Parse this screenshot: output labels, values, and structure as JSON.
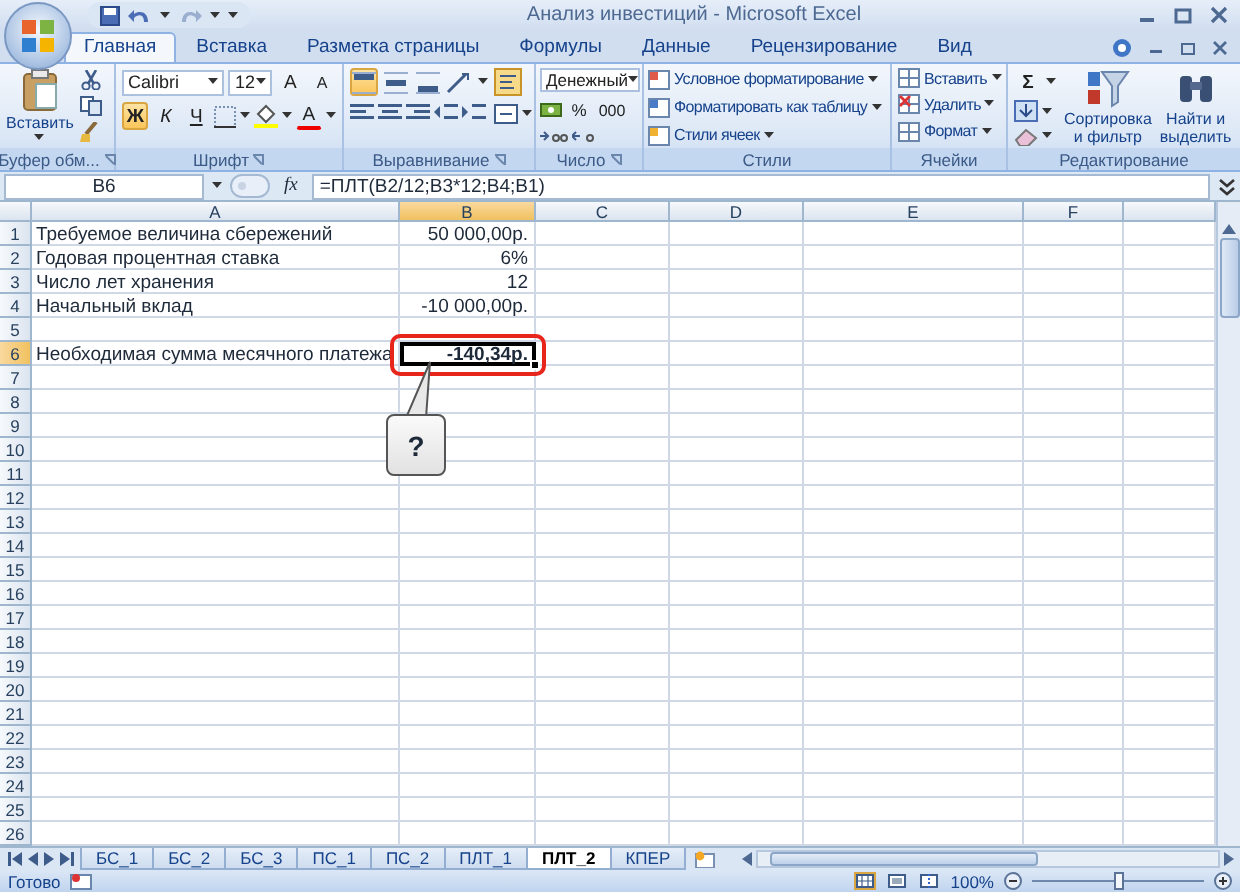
{
  "window": {
    "title": "Анализ инвестиций - Microsoft Excel"
  },
  "tabs": [
    {
      "label": "Главная",
      "selected": true
    },
    {
      "label": "Вставка",
      "selected": false
    },
    {
      "label": "Разметка страницы",
      "selected": false
    },
    {
      "label": "Формулы",
      "selected": false
    },
    {
      "label": "Данные",
      "selected": false
    },
    {
      "label": "Рецензирование",
      "selected": false
    },
    {
      "label": "Вид",
      "selected": false
    }
  ],
  "ribbon": {
    "clipboard": {
      "label": "Буфер обм...",
      "paste": "Вставить"
    },
    "font": {
      "label": "Шрифт",
      "font_name": "Calibri",
      "font_size": "12",
      "grow": "A",
      "shrink": "A",
      "font_color": "A",
      "styles": [
        {
          "label": "Ж",
          "on": true
        },
        {
          "label": "К",
          "on": false
        },
        {
          "label": "Ч",
          "on": false
        }
      ]
    },
    "alignment": {
      "label": "Выравнивание",
      "vertical": [
        {
          "kind": "top",
          "selected": true
        },
        {
          "kind": "middle",
          "selected": false
        },
        {
          "kind": "bottom",
          "selected": false
        }
      ]
    },
    "number": {
      "label": "Число",
      "format": "Денежный",
      "percent": "%",
      "thousands": "000"
    },
    "styles": {
      "label": "Стили",
      "items": [
        "Условное форматирование",
        "Форматировать как таблицу",
        "Стили ячеек"
      ]
    },
    "cells": {
      "label": "Ячейки",
      "items": [
        "Вставить",
        "Удалить",
        "Формат"
      ]
    },
    "editing": {
      "label": "Редактирование",
      "sum": "Σ",
      "sort": "Сортировка\nи фильтр",
      "find": "Найти и\nвыделить"
    }
  },
  "formula_bar": {
    "name_box": "B6",
    "fx": "fx",
    "formula": "=ПЛТ(B2/12;B3*12;B4;B1)"
  },
  "sheet": {
    "columns": [
      {
        "label": "A",
        "selected": false
      },
      {
        "label": "B",
        "selected": true
      },
      {
        "label": "C",
        "selected": false
      },
      {
        "label": "D",
        "selected": false
      },
      {
        "label": "E",
        "selected": false
      },
      {
        "label": "F",
        "selected": false
      }
    ],
    "rows": [
      {
        "number": "1",
        "selected": false,
        "cells": [
          {
            "text": "Требуемое величина сбережений",
            "selected": false,
            "bold": false
          },
          {
            "text": "50 000,00р.",
            "selected": false,
            "bold": false
          }
        ]
      },
      {
        "number": "2",
        "selected": false,
        "cells": [
          {
            "text": "Годовая процентная ставка",
            "selected": false,
            "bold": false
          },
          {
            "text": "6%",
            "selected": false,
            "bold": false
          }
        ]
      },
      {
        "number": "3",
        "selected": false,
        "cells": [
          {
            "text": "Число лет хранения",
            "selected": false,
            "bold": false
          },
          {
            "text": "12",
            "selected": false,
            "bold": false
          }
        ]
      },
      {
        "number": "4",
        "selected": false,
        "cells": [
          {
            "text": "Начальный вклад",
            "selected": false,
            "bold": false
          },
          {
            "text": "-10 000,00р.",
            "selected": false,
            "bold": false
          }
        ]
      },
      {
        "number": "5",
        "selected": false
      },
      {
        "number": "6",
        "selected": true,
        "cells": [
          {
            "text": "Необходимая сумма месячного платежа",
            "selected": false,
            "bold": false
          },
          {
            "text": "-140,34р.",
            "selected": true,
            "bold": true
          }
        ]
      },
      {
        "number": "7",
        "selected": false
      },
      {
        "number": "8",
        "selected": false
      },
      {
        "number": "9",
        "selected": false
      },
      {
        "number": "10",
        "selected": false
      },
      {
        "number": "11",
        "selected": false
      },
      {
        "number": "12",
        "selected": false
      },
      {
        "number": "13",
        "selected": false
      },
      {
        "number": "14",
        "selected": false
      },
      {
        "number": "15",
        "selected": false
      },
      {
        "number": "16",
        "selected": false
      },
      {
        "number": "17",
        "selected": false
      },
      {
        "number": "18",
        "selected": false
      },
      {
        "number": "19",
        "selected": false
      },
      {
        "number": "20",
        "selected": false
      },
      {
        "number": "21",
        "selected": false
      },
      {
        "number": "22",
        "selected": false
      },
      {
        "number": "23",
        "selected": false
      },
      {
        "number": "24",
        "selected": false
      },
      {
        "number": "25",
        "selected": false
      },
      {
        "number": "26",
        "selected": false
      }
    ]
  },
  "callout": {
    "text": "?"
  },
  "sheet_tabs": [
    {
      "label": "БС_1",
      "selected": false
    },
    {
      "label": "БС_2",
      "selected": false
    },
    {
      "label": "БС_3",
      "selected": false
    },
    {
      "label": "ПС_1",
      "selected": false
    },
    {
      "label": "ПС_2",
      "selected": false
    },
    {
      "label": "ПЛТ_1",
      "selected": false
    },
    {
      "label": "ПЛТ_2",
      "selected": true
    },
    {
      "label": "КПЕР",
      "selected": false
    }
  ],
  "status_bar": {
    "status": "Готово",
    "views": [
      {
        "kind": "normal",
        "selected": true
      },
      {
        "kind": "layout",
        "selected": false
      },
      {
        "kind": "page_break",
        "selected": false
      }
    ],
    "zoom": "100%",
    "zoom_slider": {
      "level": 0.5
    }
  }
}
